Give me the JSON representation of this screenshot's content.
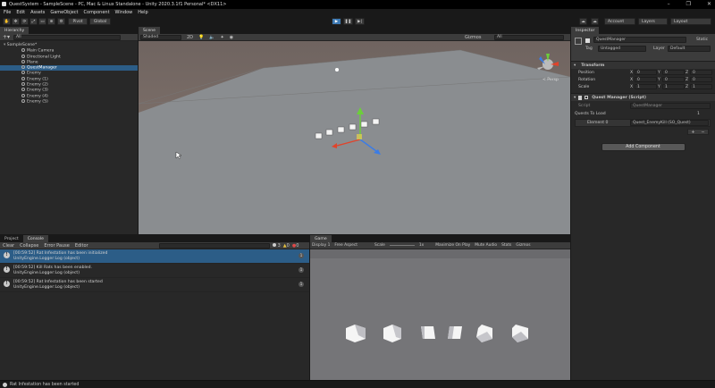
{
  "window": {
    "title": "QuestSystem - SampleScene - PC, Mac & Linux Standalone - Unity 2020.3.1f1 Personal* <DX11>",
    "controls": [
      "–",
      "❐",
      "✕"
    ]
  },
  "menu": [
    "File",
    "Edit",
    "Assets",
    "GameObject",
    "Component",
    "Window",
    "Help"
  ],
  "toolbar": {
    "pivot": "Pivot",
    "global": "Global",
    "account": "Account",
    "layers": "Layers",
    "layout": "Layout"
  },
  "hierarchy": {
    "tab": "Hierarchy",
    "search_placeholder": "All",
    "scene": "SampleScene*",
    "items": [
      "Main Camera",
      "Directional Light",
      "Plane",
      "QuestManager",
      "Enemy",
      "Enemy (1)",
      "Enemy (2)",
      "Enemy (3)",
      "Enemy (4)",
      "Enemy (5)"
    ],
    "selected_index": 3
  },
  "scene_view": {
    "tab": "Scene",
    "shading": "Shaded",
    "mode_2d": "2D",
    "gizmos": "Gizmos",
    "search_placeholder": "All",
    "persp": "< Persp"
  },
  "inspector": {
    "tab": "Inspector",
    "object_name": "QuestManager",
    "static": "Static",
    "tag_label": "Tag",
    "tag_value": "Untagged",
    "layer_label": "Layer",
    "layer_value": "Default",
    "transform": {
      "header": "Transform",
      "position_label": "Position",
      "rotation_label": "Rotation",
      "scale_label": "Scale",
      "position": {
        "x": "0",
        "y": "0",
        "z": "0"
      },
      "rotation": {
        "x": "0",
        "y": "0",
        "z": "0"
      },
      "scale": {
        "x": "1",
        "y": "1",
        "z": "1"
      }
    },
    "script_comp": {
      "header": "Quest Manager (Script)",
      "script_label": "Script",
      "script_value": "QuestManager",
      "list_label": "Quests To Load",
      "list_count": "1",
      "element_label": "Element 0",
      "element_value": "Quest_EnemyKill (SO_Quest)"
    },
    "add_component": "Add Component"
  },
  "bottom": {
    "tabs": [
      "Project",
      "Console"
    ],
    "buttons": [
      "Clear",
      "Collapse",
      "Error Pause",
      "Editor"
    ],
    "counts": {
      "info": "3",
      "warn": "0",
      "error": "0"
    },
    "logs": [
      {
        "line1": "[00:59:52] Rat Infestation has been initialized",
        "line2": "UnityEngine.Logger:Log (object)",
        "count": "1"
      },
      {
        "line1": "[00:59:52] Kill Rats has been enabled.",
        "line2": "UnityEngine.Logger:Log (object)",
        "count": "1"
      },
      {
        "line1": "[00:59:52] Rat Infestation has been started",
        "line2": "UnityEngine.Logger:Log (object)",
        "count": "1"
      }
    ]
  },
  "game_view": {
    "tab": "Game",
    "display": "Display 1",
    "aspect": "Free Aspect",
    "scale_label": "Scale",
    "scale_value": "1x",
    "maximize": "Maximize On Play",
    "mute": "Mute Audio",
    "stats": "Stats",
    "gizmos": "Gizmos"
  },
  "status": "Rat Infestation has been started"
}
